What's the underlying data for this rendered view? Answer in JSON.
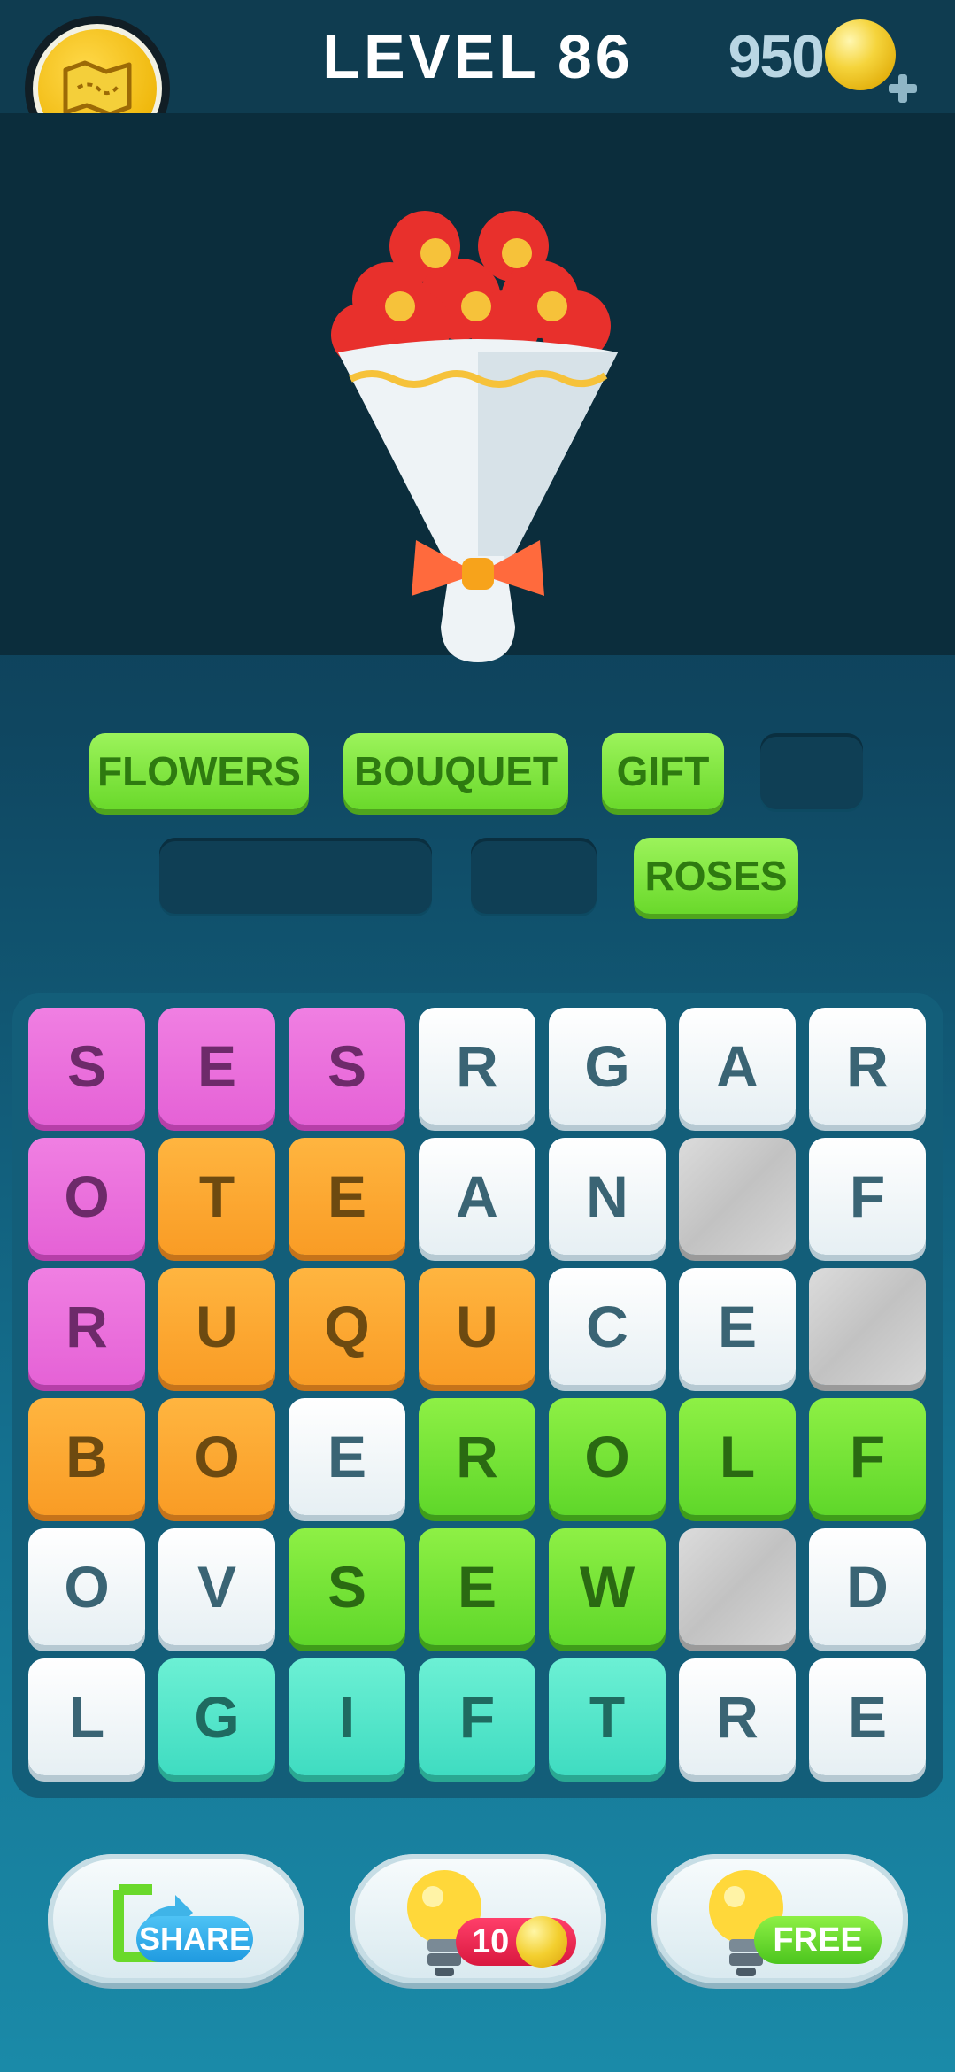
{
  "header": {
    "level_label": "LEVEL",
    "level_number": "86",
    "coins": "950"
  },
  "picture": {
    "icon": "flower-bouquet"
  },
  "answers": [
    {
      "word": "FLOWERS",
      "state": "solved"
    },
    {
      "word": "BOUQUET",
      "state": "solved"
    },
    {
      "word": "GIFT",
      "state": "solved"
    },
    {
      "word": "",
      "state": "empty"
    },
    {
      "word": "",
      "state": "empty"
    },
    {
      "word": "",
      "state": "empty"
    },
    {
      "word": "ROSES",
      "state": "solved"
    }
  ],
  "grid": {
    "rows": 6,
    "cols": 7,
    "letters": [
      [
        "S",
        "E",
        "S",
        "R",
        "G",
        "A",
        "R"
      ],
      [
        "O",
        "T",
        "E",
        "A",
        "N",
        "",
        "F"
      ],
      [
        "R",
        "U",
        "Q",
        "U",
        "C",
        "E",
        ""
      ],
      [
        "B",
        "O",
        "E",
        "R",
        "O",
        "L",
        "F"
      ],
      [
        "O",
        "V",
        "S",
        "E",
        "W",
        "",
        "D"
      ],
      [
        "L",
        "G",
        "I",
        "F",
        "T",
        "R",
        "E"
      ]
    ],
    "colors": [
      [
        "pink",
        "pink",
        "pink",
        "white",
        "white",
        "white",
        "white"
      ],
      [
        "pink",
        "orange",
        "orange",
        "white",
        "white",
        "stone",
        "white"
      ],
      [
        "pink",
        "orange",
        "orange",
        "orange",
        "white",
        "white",
        "stone"
      ],
      [
        "orange",
        "orange",
        "white",
        "green",
        "green",
        "green",
        "green"
      ],
      [
        "white",
        "white",
        "green",
        "green",
        "green",
        "stone",
        "white"
      ],
      [
        "white",
        "teal",
        "teal",
        "teal",
        "teal",
        "white",
        "white"
      ]
    ]
  },
  "buttons": {
    "share_label": "SHARE",
    "hint_cost": "10",
    "free_label": "FREE"
  },
  "colors": {
    "solved_green": "#6ad92b",
    "pink": "#e562d6",
    "orange": "#f99c25",
    "teal": "#3fdcc1"
  }
}
